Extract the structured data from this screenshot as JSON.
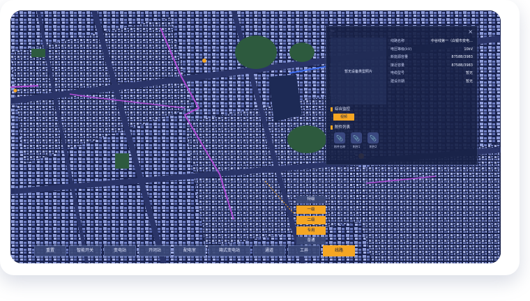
{
  "info_panel": {
    "dots_label": "···",
    "close_label": "×",
    "photo_label": "暂无设备类型照片",
    "rows": [
      {
        "key": "线路名称",
        "value": "中谷线第一（白银市变电…"
      },
      {
        "key": "电压等级(kV)",
        "value": "10kV"
      },
      {
        "key": "新能源容量",
        "value": "8758B/3983"
      },
      {
        "key": "接近容量",
        "value": "8758B/3983"
      },
      {
        "key": "电缆型号",
        "value": "暂无"
      },
      {
        "key": "建设日期",
        "value": "暂无"
      }
    ],
    "section_monitor": "综合监控",
    "monitor_button": "视频",
    "section_attachments": "附件列表",
    "attachments": [
      {
        "name": "附件名称",
        "icon": "paperclip-icon"
      },
      {
        "name": "附件1",
        "icon": "paperclip-icon"
      },
      {
        "name": "附件2",
        "icon": "paperclip-icon"
      }
    ]
  },
  "toolbar": {
    "buttons": [
      {
        "label": "重置",
        "active": false
      },
      {
        "label": "智能开关",
        "active": false
      },
      {
        "label": "变电站",
        "active": false
      },
      {
        "label": "开闭站",
        "active": false
      },
      {
        "label": "配电室",
        "active": false
      },
      {
        "label": "箱式变电站",
        "active": false
      },
      {
        "label": "通道",
        "active": false
      },
      {
        "label": "工井",
        "active": false
      },
      {
        "label": "线路",
        "active": true
      }
    ]
  },
  "legend": {
    "header_top": "特级",
    "items": [
      "一级",
      "二级",
      "专用"
    ],
    "header_bottom": "普通"
  },
  "colors": {
    "accent": "#f5a623",
    "panel_bg": "#182246",
    "toolbar_bg": "#3a4876",
    "map_bg": "#121a3a"
  }
}
